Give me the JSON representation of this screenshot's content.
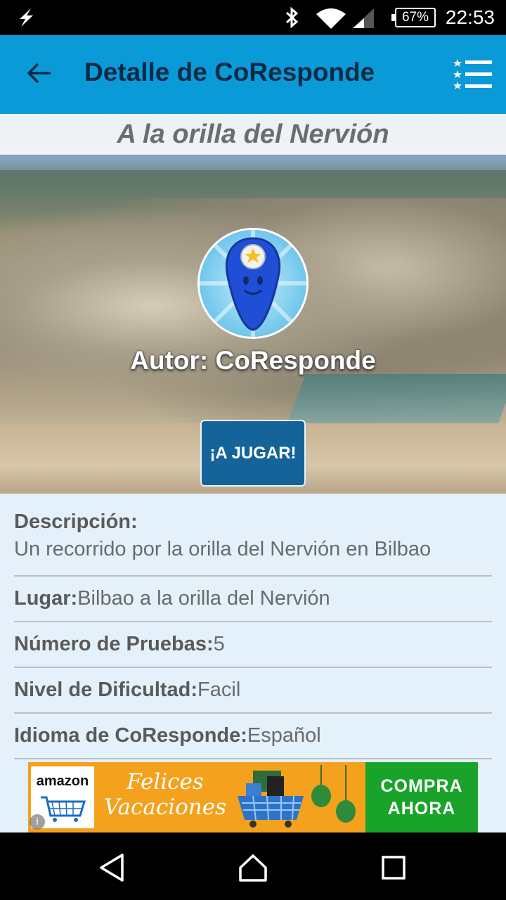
{
  "status_bar": {
    "battery": "67%",
    "time": "22:53"
  },
  "app_bar": {
    "title": "Detalle de CoResponde"
  },
  "hero": {
    "subtitle": "A la orilla del Nervión",
    "author": "Autor: CoResponde",
    "play_button": "¡A JUGAR!"
  },
  "details": {
    "description_label": "Descripción:",
    "description_value": "Un recorrido por la orilla del Nervión en Bilbao",
    "place_label": "Lugar:",
    "place_value": "Bilbao a la orilla del Nervión",
    "tests_label": "Número de Pruebas:",
    "tests_value": "5",
    "difficulty_label": "Nivel de Dificultad:",
    "difficulty_value": "Facil",
    "language_label": "Idioma de CoResponde:",
    "language_value": "Español"
  },
  "ad": {
    "brand": "amazon",
    "headline_line1": "Felices",
    "headline_line2": "Vacaciones",
    "cta_line1": "COMPRA",
    "cta_line2": "AHORA",
    "info": "i"
  },
  "colors": {
    "app_bar": "#0a9ad8",
    "title": "#0d2a44",
    "play_button": "#14649a",
    "details_bg": "#e4f1fb",
    "ad_bg": "#f4a11d",
    "ad_cta": "#1aa32a"
  },
  "icons": [
    "flash-icon",
    "bluetooth-icon",
    "wifi-icon",
    "signal-icon",
    "battery-icon",
    "back-arrow-icon",
    "starred-list-icon",
    "back-nav-icon",
    "home-nav-icon",
    "recents-nav-icon"
  ]
}
